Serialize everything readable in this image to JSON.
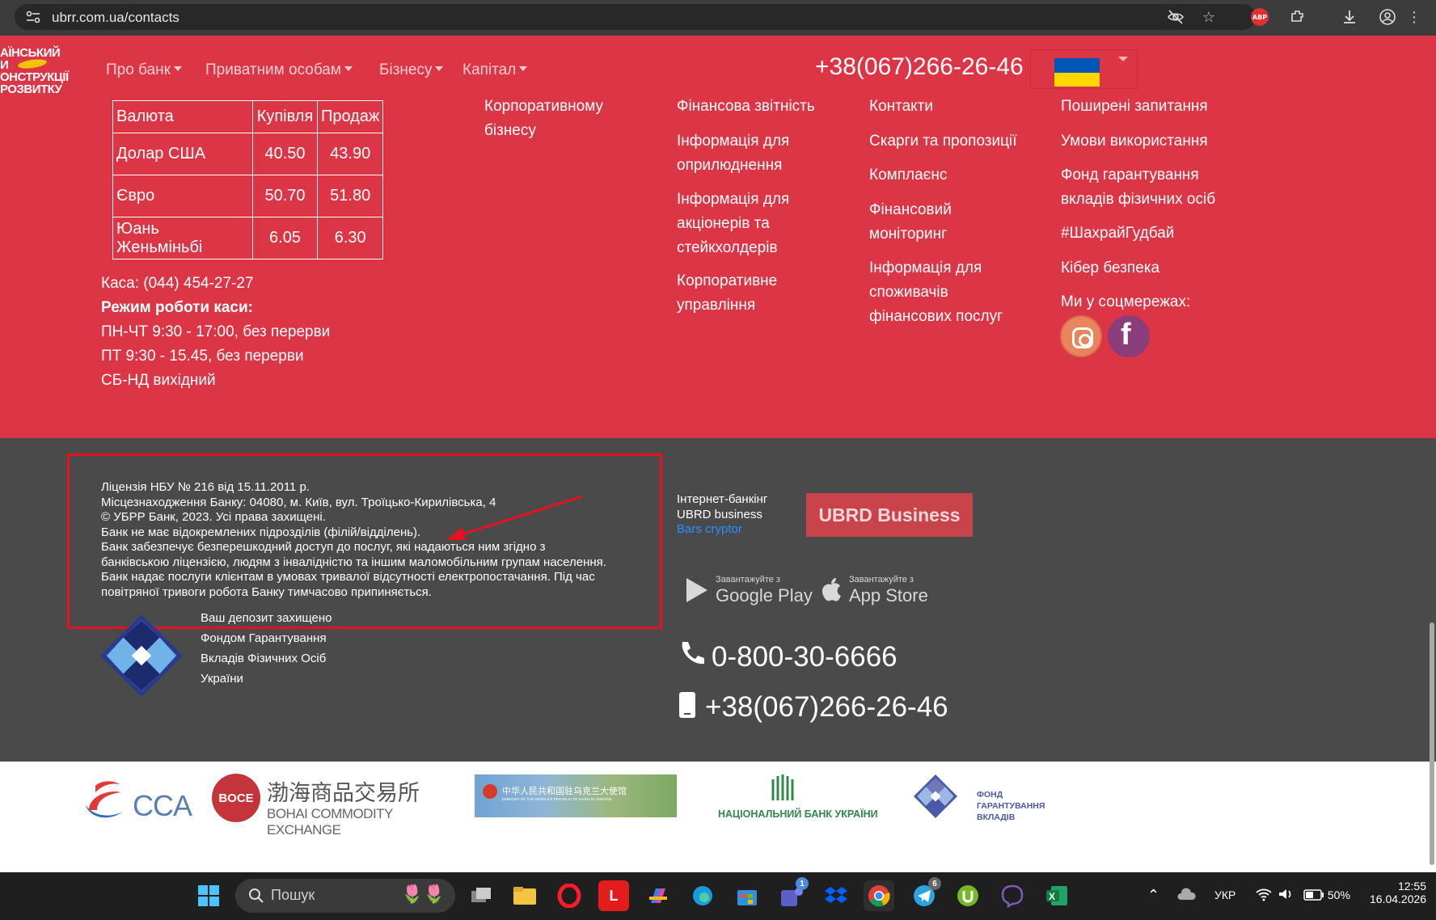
{
  "browser": {
    "url": "ubrr.com.ua/contacts",
    "abp_label": "ABP"
  },
  "logo": {
    "lines": [
      "АЇНСЬКИЙ",
      "И",
      "ОНСТРУКЦІЇ",
      "РОЗВИТКУ"
    ]
  },
  "nav": {
    "items": [
      "Про банк",
      "Приватним особам",
      "Бізнесу",
      "Капітал"
    ],
    "phone": "+38(067)266-26-46"
  },
  "currency_table": {
    "headers": [
      "Валюта",
      "Купівля",
      "Продаж"
    ],
    "rows": [
      [
        "Долар США",
        "40.50",
        "43.90"
      ],
      [
        "Євро",
        "50.70",
        "51.80"
      ],
      [
        "Юань Женьміньбі",
        "6.05",
        "6.30"
      ]
    ]
  },
  "cashier": {
    "phone": "Каса: (044) 454-27-27",
    "hours_title": "Режим роботи каси:",
    "hours": [
      "ПН-ЧТ 9:30 - 17:00, без перерви",
      "ПТ 9:30 - 15.45, без перерви",
      "СБ-НД вихідний"
    ]
  },
  "footer_links": {
    "col1": [
      "Корпоративному бізнесу"
    ],
    "col2": [
      "Фінансова звітність",
      "Інформація для оприлюднення",
      "Інформація для акціонерів та стейкхолдерів",
      "Корпоративне управління"
    ],
    "col3": [
      "Контакти",
      "Скарги та пропозиції",
      "Комплаєнс",
      "Фінансовий моніторинг",
      "Інформація для споживачів фінансових послуг"
    ],
    "col4": [
      "Поширені запитання",
      "Умови використання",
      "Фонд гарантування вкладів фізичних осіб",
      "#ШахрайГудбай",
      "Кібер безпека",
      "Ми у соцмережах:"
    ]
  },
  "legal": {
    "lines": [
      "Ліцензія НБУ № 216 від 15.11.2011 р.",
      "Місцезнаходження Банку: 04080, м. Київ, вул. Троїцько-Кирилівська, 4",
      "© УБРР Банк, 2023. Усі права захищені.",
      "Банк не має відокремлених підрозділів (філій/відділень).",
      "Банк забезпечує безперешкодний доступ до послуг, які надаються ним згідно з",
      "банківською ліцензією, людям з інвалідністю та іншим маломобільним групам населення.",
      "Банк надає послуги клієнтам в умовах тривалої відсутності електропостачання. Під час",
      "повітряної тривоги робота Банку тимчасово припиняється."
    ]
  },
  "deposit": {
    "lines": [
      "Ваш депозит захищено",
      "Фондом Гарантування",
      "Вкладів Фізичних Осіб",
      "України"
    ]
  },
  "internet_banking": {
    "line1": "Інтернет-банкінг",
    "line2": "UBRD business",
    "link": "Bars cryptor",
    "button": "UBRD Business"
  },
  "stores": {
    "google_small": "Завантажуйте з",
    "google_big": "Google Play",
    "apple_small": "Завантажуйте з",
    "apple_big": "App Store"
  },
  "hotline": {
    "free": "0-800-30-6666",
    "mobile": "+38(067)266-26-46"
  },
  "partners": {
    "cca": "CCA",
    "boce_badge": "BOCE",
    "boce_cn": "渤海商品交易所",
    "boce_en": "BOHAI COMMODITY EXCHANGE",
    "embassy": "中华人民共和国驻乌克兰大使馆",
    "embassy_en": "EMBASSY OF THE PEOPLE'S REPUBLIC OF CHINA IN UKRAINE",
    "nbu": "НАЦІОНАЛЬНИЙ БАНК УКРАЇНИ",
    "fgvfo": [
      "ФОНД",
      "ГАРАНТУВАННЯ",
      "ВКЛАДІВ"
    ]
  },
  "taskbar": {
    "search": "Пошук",
    "lang": "УКР",
    "battery": "50%",
    "time": "12:55",
    "date": "16.04.2026",
    "teams_badge": "1",
    "telegram_badge": "6"
  },
  "colors": {
    "red": "#dc3545",
    "dark": "#4a4a4a",
    "highlight": "#e8101e"
  }
}
